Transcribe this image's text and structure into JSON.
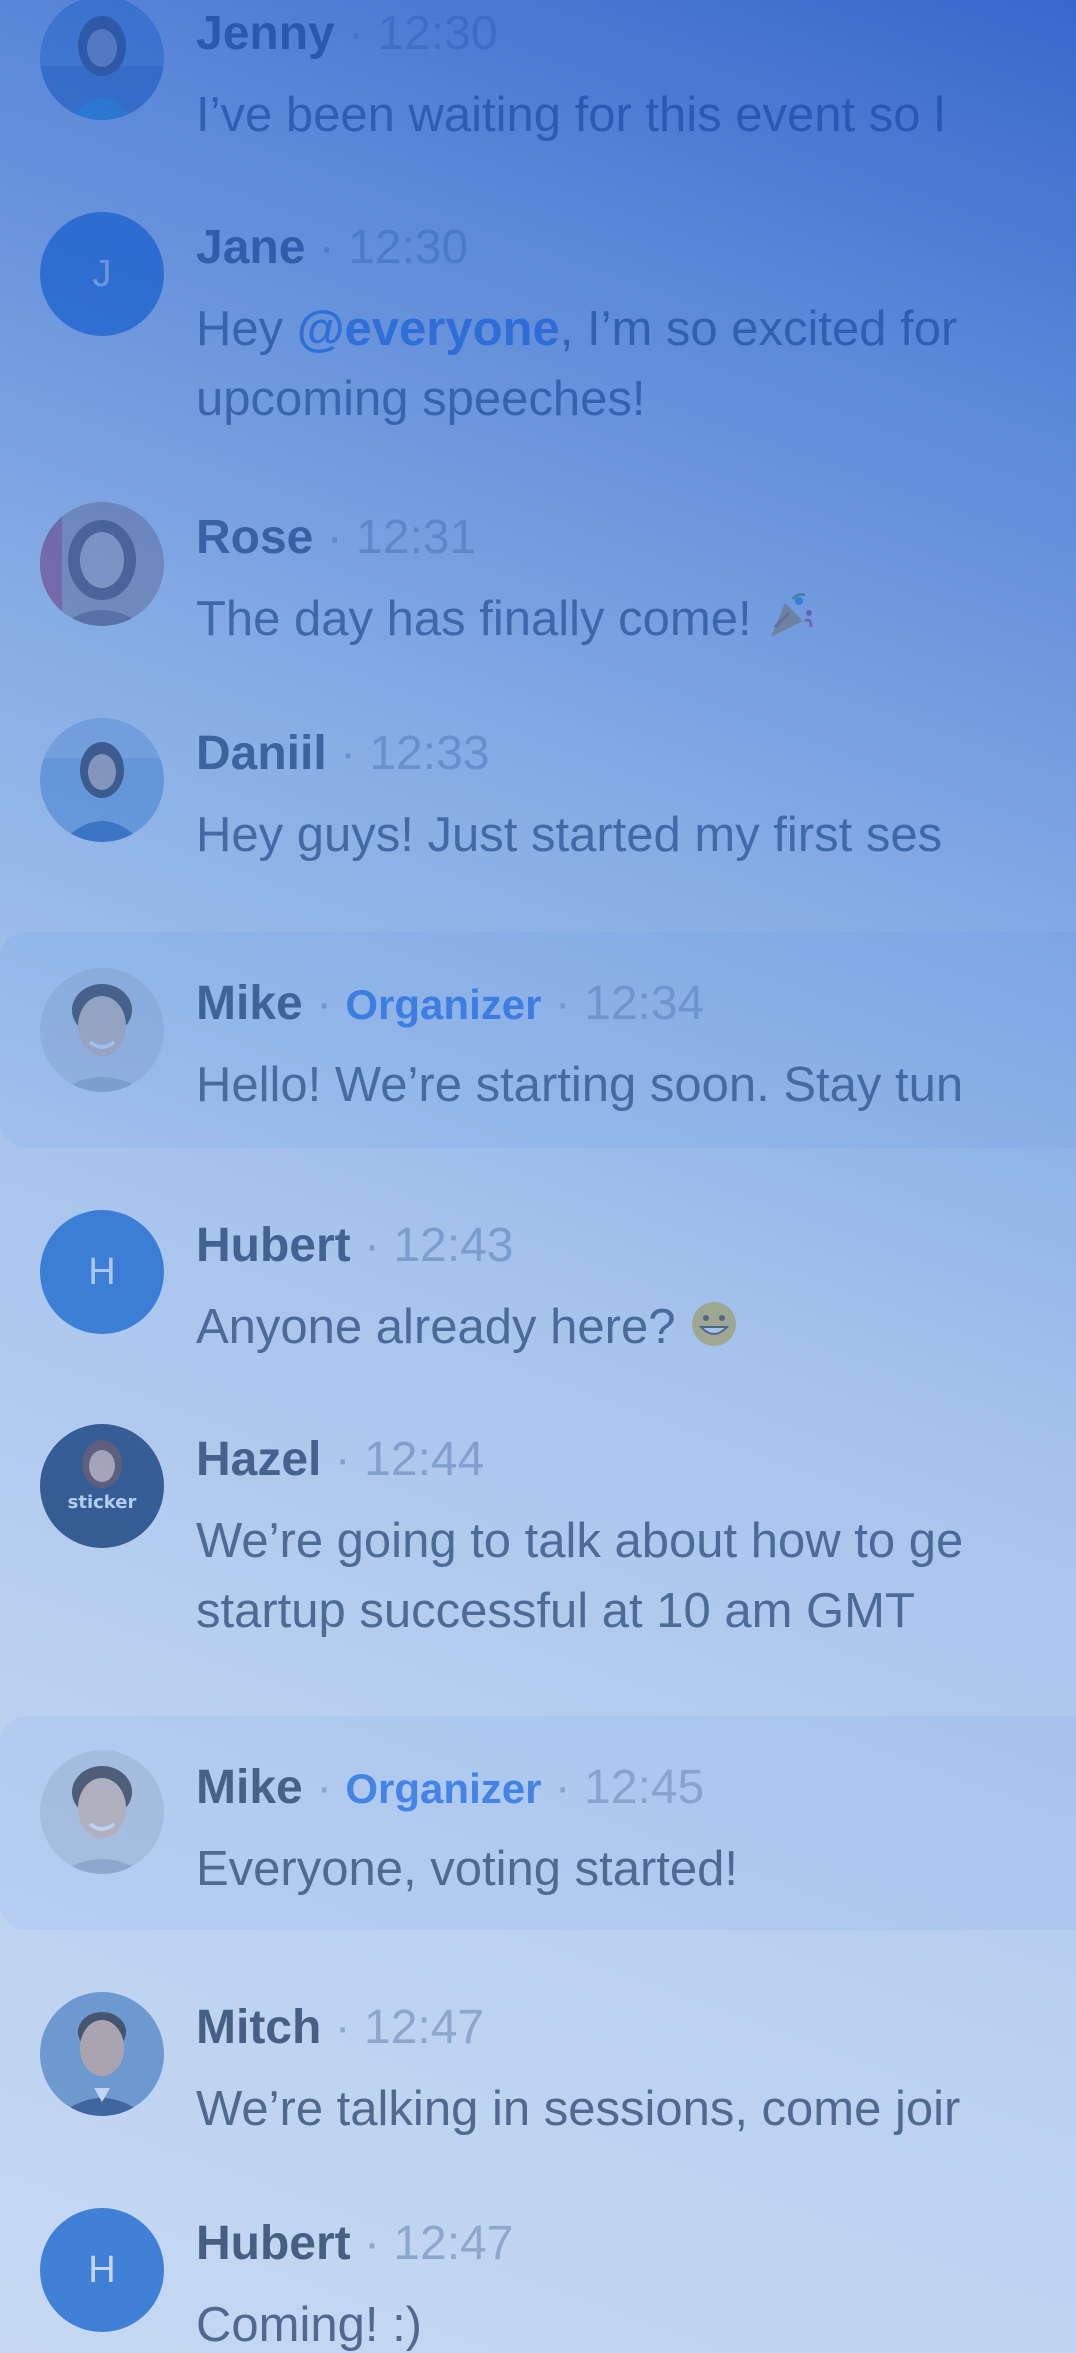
{
  "messages": [
    {
      "name": "Jenny",
      "time": "12:30",
      "text": "I’ve been waiting for this event so l"
    },
    {
      "name": "Jane",
      "initial": "J",
      "time": "12:30",
      "text_before": "Hey ",
      "mention": "@everyone",
      "text_after": ", I’m so excited for",
      "text_line2": "upcoming speeches!"
    },
    {
      "name": "Rose",
      "time": "12:31",
      "text": "The day has finally come! "
    },
    {
      "name": "Daniil",
      "time": "12:33",
      "text": "Hey guys! Just started my first ses"
    },
    {
      "name": "Mike",
      "role": "Organizer",
      "time": "12:34",
      "text": "Hello! We’re starting soon. Stay tun"
    },
    {
      "name": "Hubert",
      "initial": "H",
      "time": "12:43",
      "text": "Anyone already here? "
    },
    {
      "name": "Hazel",
      "time": "12:44",
      "text": "We’re going to talk about how to ge",
      "text_line2": "startup successful at 10 am GMT",
      "avatar_text": "sticker"
    },
    {
      "name": "Mike",
      "role": "Organizer",
      "time": "12:45",
      "text": "Everyone, voting started!"
    },
    {
      "name": "Mitch",
      "time": "12:47",
      "text": "We’re talking in sessions, come joir"
    },
    {
      "name": "Hubert",
      "initial": "H",
      "time": "12:47",
      "text": "Coming! :)"
    }
  ],
  "separator": "·",
  "colors": {
    "accent": "#2a72ee",
    "name": "#2b3340",
    "muted": "#a7b0bd",
    "body_text": "#3c4552",
    "initial_avatar_bg": "#1f6bd0",
    "organizer_row_bg": "#eef4fd",
    "overlay_top": "#1d52c4",
    "overlay_bottom": "#709ee0"
  }
}
